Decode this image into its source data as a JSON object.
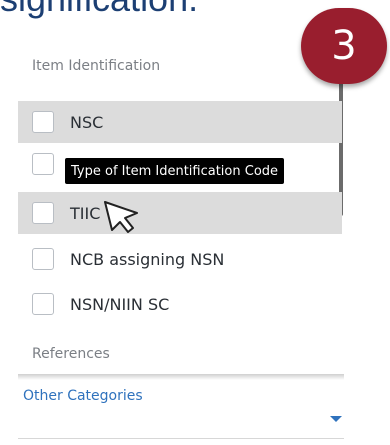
{
  "slide": {
    "title": "signification."
  },
  "step_badge": "3",
  "filter_panel": {
    "section_header": "Item Identification",
    "options": [
      {
        "label": "NSC",
        "checked": false,
        "highlighted": true
      },
      {
        "label": "",
        "checked": false,
        "highlighted": false
      },
      {
        "label": "TIIC",
        "checked": false,
        "highlighted": true
      },
      {
        "label": "NCB assigning NSN",
        "checked": false,
        "highlighted": false
      },
      {
        "label": "NSN/NIIN SC",
        "checked": false,
        "highlighted": false
      }
    ],
    "tooltip": "Type of Item Identification Code",
    "references_header": "References",
    "other_categories_label": "Other Categories"
  },
  "colors": {
    "accent": "#2f72bd",
    "badge": "#991e2e",
    "title": "#1c3f73",
    "highlight_row": "#dcdcdc"
  }
}
